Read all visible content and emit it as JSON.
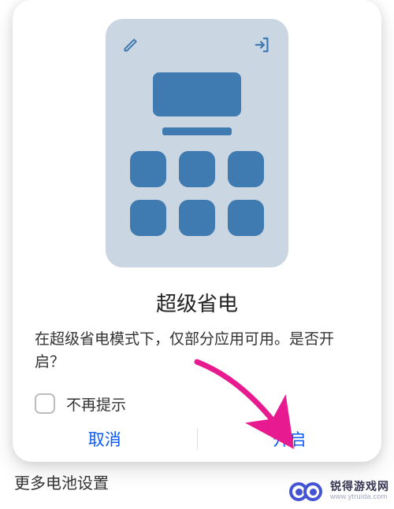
{
  "dialog": {
    "title": "超级省电",
    "description": "在超级省电模式下，仅部分应用可用。是否开启？",
    "checkbox_label": "不再提示",
    "cancel_label": "取消",
    "confirm_label": "开启"
  },
  "more_settings_label": "更多电池设置",
  "icons": {
    "edit": "edit-icon",
    "exit": "exit-icon"
  },
  "colors": {
    "accent": "#0a59f7",
    "illustration_bg": "#cbd6e3",
    "illustration_fg": "#3f7ab1",
    "arrow": "#e81a8f"
  },
  "watermark": {
    "brand_cn": "锐得游戏网",
    "url": "www.ytruida.com"
  }
}
